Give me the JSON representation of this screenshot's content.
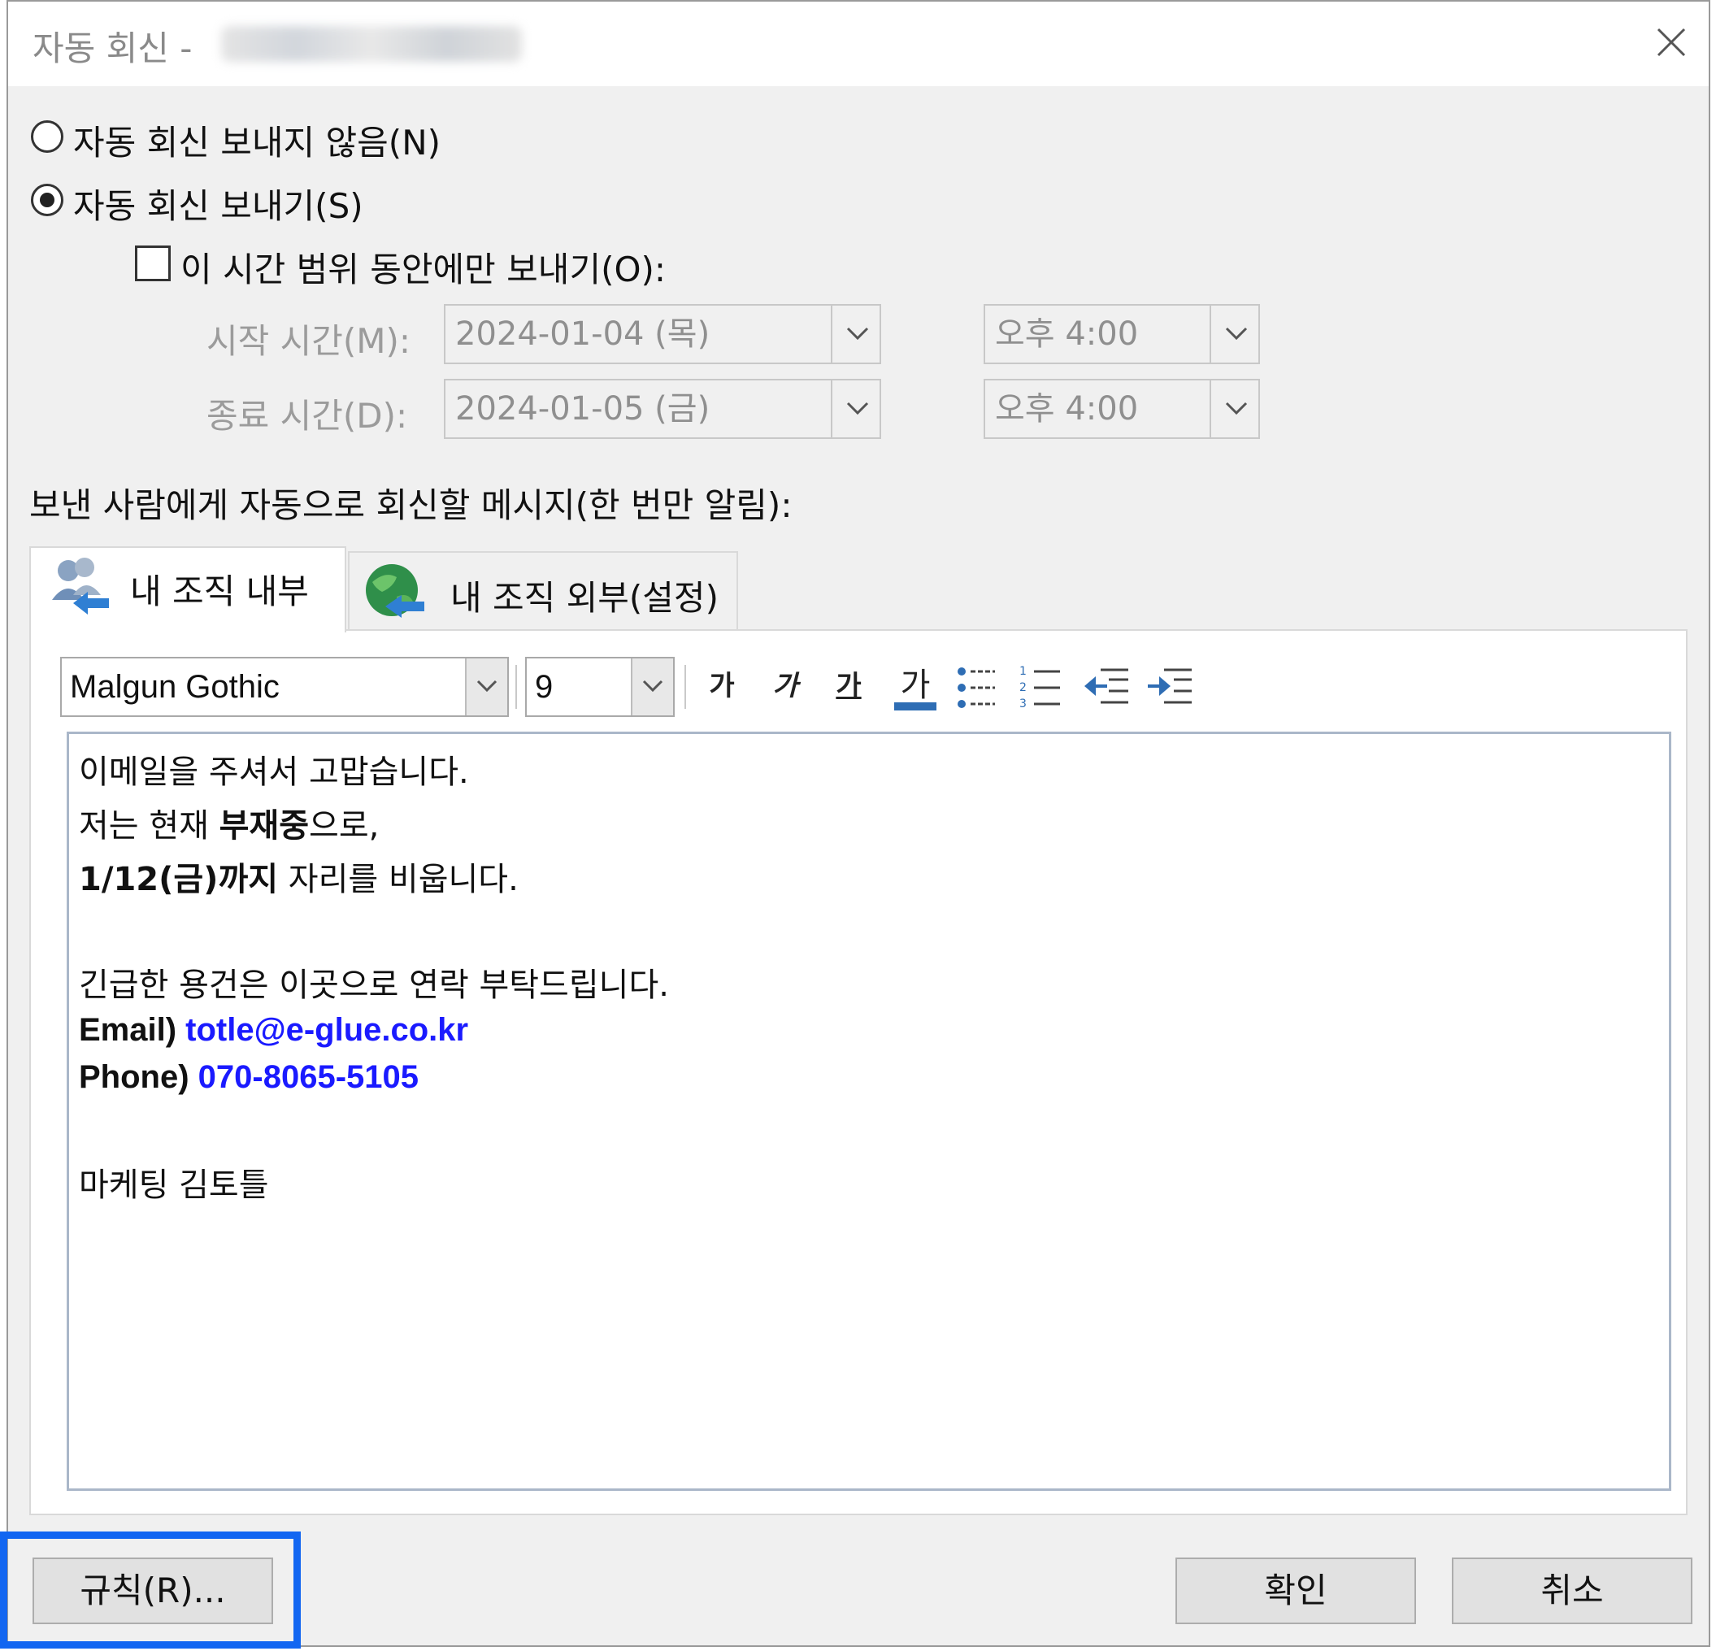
{
  "window": {
    "title": "자동 회신 - ",
    "title_blurred_account": "",
    "close_icon": "close-icon"
  },
  "options": {
    "no_auto_reply": "자동 회신 보내지 않음(N)",
    "send_auto_reply": "자동 회신 보내기(S)",
    "selected": "send_auto_reply",
    "time_range_only": "이 시간 범위 동안에만 보내기(O):",
    "time_range_checked": false
  },
  "schedule": {
    "start_label": "시작 시간(M):",
    "start_date": "2024-01-04 (목)",
    "start_time": "오후 4:00",
    "end_label": "종료 시간(D):",
    "end_date": "2024-01-05 (금)",
    "end_time": "오후 4:00"
  },
  "message_label": "보낸 사람에게 자동으로 회신할 메시지(한 번만 알림):",
  "tabs": [
    {
      "label": "내 조직 내부",
      "icon": "internal-people-icon",
      "active": true
    },
    {
      "label": "내 조직 외부(설정)",
      "icon": "globe-icon",
      "active": false
    }
  ],
  "toolbar": {
    "font": "Malgun Gothic",
    "size": "9",
    "bold": "가",
    "italic": "가",
    "underline": "가",
    "font_color": "가",
    "accent": "#2e6db4"
  },
  "message": {
    "line1": "이메일을 주셔서 고맙습니다.",
    "line2_pre": "저는 현재 ",
    "line2_bold": "부재중",
    "line2_post": "으로,",
    "line3_bold": "1/12(금)까지",
    "line3_post": " 자리를 비웁니다.",
    "line4": "긴급한 용건은 이곳으로 연락 부탁드립니다.",
    "email_label": "Email) ",
    "email": "totle@e-glue.co.kr",
    "phone_label": "Phone) ",
    "phone": "070-8065-5105",
    "signature": "마케팅 김토틀",
    "link_color": "#1a1aff"
  },
  "buttons": {
    "rules": "규칙(R)...",
    "ok": "확인",
    "cancel": "취소"
  },
  "highlight_color": "#1266f1"
}
